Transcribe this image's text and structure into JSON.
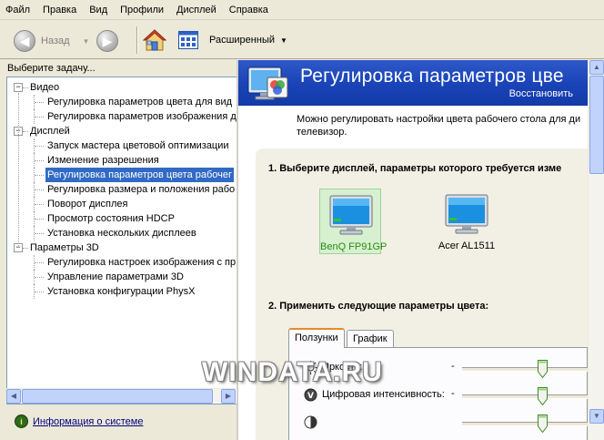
{
  "menu": [
    "Файл",
    "Правка",
    "Вид",
    "Профили",
    "Дисплей",
    "Справка"
  ],
  "toolbar": {
    "back_label": "Назад",
    "view_label": "Расширенный"
  },
  "left": {
    "task_label": "Выберите задачу...",
    "tree": [
      {
        "type": "cat",
        "label": "Видео"
      },
      {
        "type": "leaf",
        "label": "Регулировка параметров цвета для вид"
      },
      {
        "type": "leaf",
        "label": "Регулировка параметров изображения д"
      },
      {
        "type": "cat",
        "label": "Дисплей"
      },
      {
        "type": "leaf",
        "label": "Запуск мастера цветовой оптимизации"
      },
      {
        "type": "leaf",
        "label": "Изменение разрешения"
      },
      {
        "type": "leaf",
        "label": "Регулировка параметров цвета рабочег",
        "selected": true
      },
      {
        "type": "leaf",
        "label": "Регулировка размера и положения рабо"
      },
      {
        "type": "leaf",
        "label": "Поворот дисплея"
      },
      {
        "type": "leaf",
        "label": "Просмотр состояния HDCP"
      },
      {
        "type": "leaf",
        "label": "Установка нескольких дисплеев"
      },
      {
        "type": "cat",
        "label": "Параметры 3D"
      },
      {
        "type": "leaf",
        "label": "Регулировка настроек изображения с пр"
      },
      {
        "type": "leaf",
        "label": "Управление параметрами 3D"
      },
      {
        "type": "leaf",
        "label": "Установка конфигурации PhysX"
      }
    ],
    "info_link": "Информация о системе"
  },
  "right": {
    "title": "Регулировка параметров цве",
    "restore": "Восстановить",
    "description": "Можно регулировать настройки цвета рабочего стола для ди телевизор.",
    "step1": "1. Выберите дисплей, параметры которого требуется изме",
    "displays": [
      {
        "name": "BenQ FP91GP",
        "selected": true
      },
      {
        "name": "Acer AL1511",
        "selected": false
      }
    ],
    "step2": "2. Применить следующие параметры цвета:",
    "tabs": [
      "Ползунки",
      "График"
    ],
    "active_tab": 0,
    "sliders": [
      {
        "label": "Яркость:",
        "minus": "-",
        "value": 0.63
      },
      {
        "label": "Цифровая интенсивность:",
        "minus": "-",
        "value": 0.63
      },
      {
        "label": "",
        "minus": "",
        "value": 0.63
      }
    ]
  },
  "watermark": "WINDATA.RU",
  "colors": {
    "header": "#1a44b8",
    "selection": "#316ac5",
    "display_selected_text": "#2e8b12",
    "tab_active": "#e68b2c"
  }
}
